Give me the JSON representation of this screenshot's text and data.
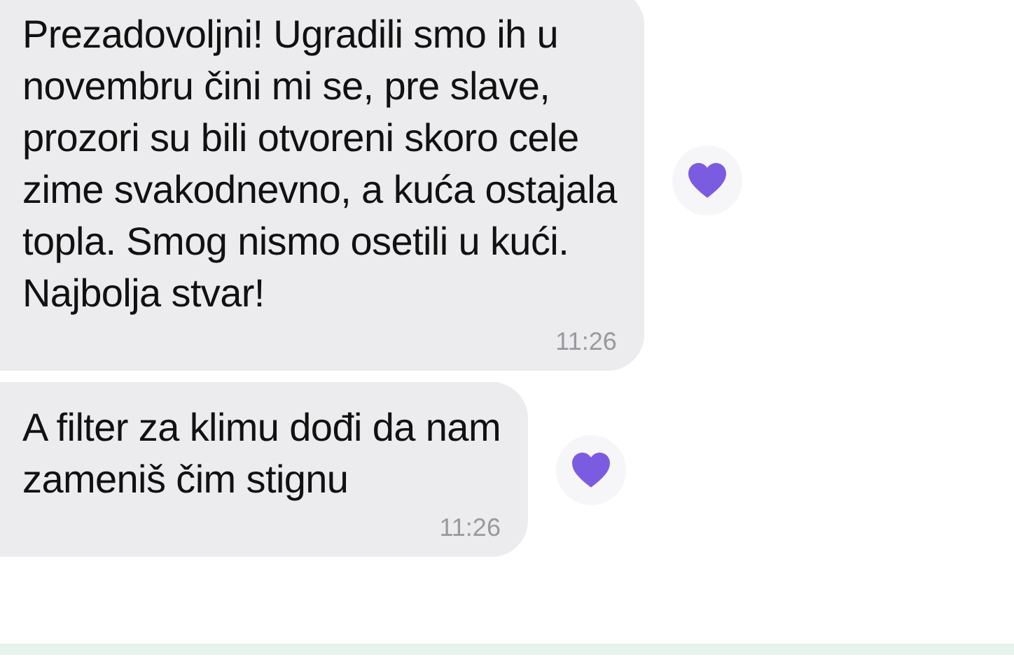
{
  "messages": [
    {
      "text": "Prezadovoljni! Ugradili smo ih u\nnovembru čini mi se, pre slave,\nprozori su bili otvoreni skoro cele\nzime svakodnevno, a kuća ostajala\ntopla. Smog nismo osetili u kući.\nNajbolja stvar!",
      "time": "11:26",
      "liked": true
    },
    {
      "text": "A filter za klimu dođi da nam\nzameniš čim stignu",
      "time": "11:26",
      "liked": true
    }
  ]
}
